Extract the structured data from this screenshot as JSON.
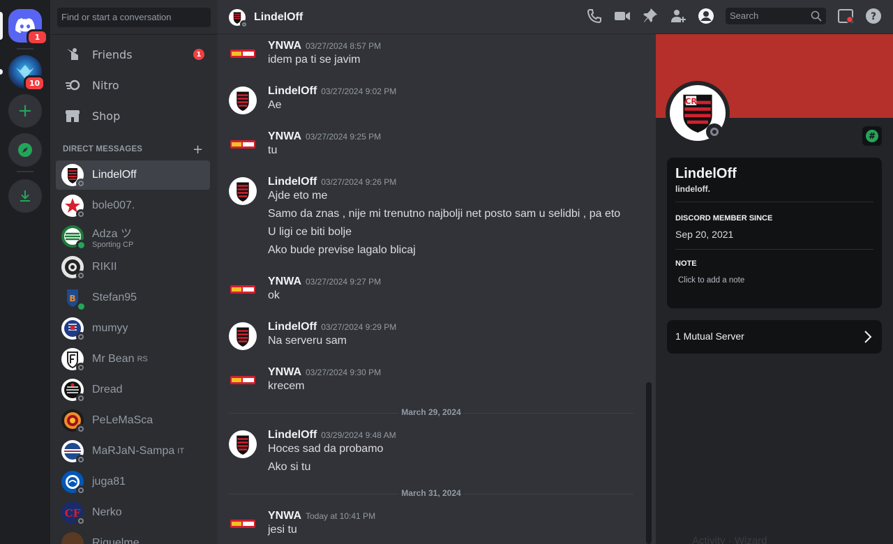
{
  "app": {
    "name": "Discord"
  },
  "colors": {
    "blurple": "#5865f2",
    "red": "#f23f42",
    "green": "#23a55a",
    "banner": "#b5302a"
  },
  "rail": {
    "home_badge": "1",
    "server_badge": "10"
  },
  "sidebar": {
    "search_placeholder": "Find or start a conversation",
    "nav": [
      {
        "label": "Friends",
        "icon": "friends-icon",
        "badge": "1"
      },
      {
        "label": "Nitro",
        "icon": "nitro-icon"
      },
      {
        "label": "Shop",
        "icon": "shop-icon"
      }
    ],
    "dm_header": "DIRECT MESSAGES",
    "dms": [
      {
        "name": "LindelOff",
        "status": "offline",
        "active": true
      },
      {
        "name": "bole007.",
        "status": "offline"
      },
      {
        "name": "Adza ツ",
        "sub": "Sporting CP",
        "status": "online"
      },
      {
        "name": "RIKII",
        "status": "offline"
      },
      {
        "name": "Stefan95",
        "status": "online"
      },
      {
        "name": "mumyy",
        "status": "offline"
      },
      {
        "name": "Mr Bean",
        "tag": "RS",
        "status": "offline"
      },
      {
        "name": "Dread",
        "status": "offline"
      },
      {
        "name": "PeLeMaSca",
        "status": "offline"
      },
      {
        "name": "MaRJaN-Sampa",
        "tag": "IT",
        "status": "offline"
      },
      {
        "name": "juga81",
        "status": "offline"
      },
      {
        "name": "Nerko",
        "status": "offline"
      },
      {
        "name": "Riquelme",
        "status": "offline"
      }
    ]
  },
  "header": {
    "title": "LindelOff",
    "search_placeholder": "Search"
  },
  "messages": [
    {
      "author": "YNWA",
      "time": "03/27/2024 8:57 PM",
      "lines": [
        "idem pa ti se javim"
      ]
    },
    {
      "author": "LindelOff",
      "time": "03/27/2024 9:02 PM",
      "lines": [
        "Ae"
      ]
    },
    {
      "author": "YNWA",
      "time": "03/27/2024 9:25 PM",
      "lines": [
        "tu"
      ]
    },
    {
      "author": "LindelOff",
      "time": "03/27/2024 9:26 PM",
      "lines": [
        "Ajde eto me",
        "Samo da znas , nije mi trenutno najbolji net posto sam u selidbi , pa eto",
        "U ligi ce biti bolje",
        "Ako bude previse lagalo blicaj"
      ]
    },
    {
      "author": "YNWA",
      "time": "03/27/2024 9:27 PM",
      "lines": [
        "ok"
      ]
    },
    {
      "author": "LindelOff",
      "time": "03/27/2024 9:29 PM",
      "lines": [
        "Na serveru sam"
      ]
    },
    {
      "author": "YNWA",
      "time": "03/27/2024 9:30 PM",
      "lines": [
        "krecem"
      ]
    },
    {
      "author": "LindelOff",
      "time": "03/29/2024 9:48 AM",
      "lines": [
        "Hoces sad da probamo",
        "Ako si tu"
      ]
    },
    {
      "author": "YNWA",
      "time": "Today at 10:41 PM",
      "lines": [
        "jesi tu"
      ]
    }
  ],
  "dividers": [
    "March 29, 2024",
    "March 31, 2024"
  ],
  "profile": {
    "name": "LindelOff",
    "username": "lindeloff.",
    "member_since_label": "DISCORD MEMBER SINCE",
    "member_since": "Sep 20, 2021",
    "note_label": "NOTE",
    "note_placeholder": "Click to add a note",
    "mutual": "1 Mutual Server",
    "cutoff": "Activity  ·  Wizard"
  }
}
